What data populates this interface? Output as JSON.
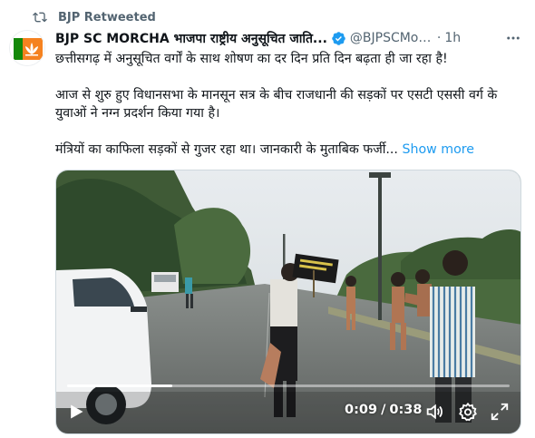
{
  "retweet": {
    "label": "BJP Retweeted",
    "icon": "retweet-icon"
  },
  "author": {
    "display_name": "BJP SC MORCHA भाजपा राष्ट्रीय अनुसूचित जाति...",
    "handle": "@BJPSCMor...",
    "dot": "·",
    "time": "1h",
    "verified": true,
    "verified_color": "#1d9bf0",
    "avatar_icon": "bjp-lotus-flag-avatar"
  },
  "tweet": {
    "paragraph1": "छत्तीसगढ़ में अनुसूचित वर्गों के साथ शोषण का दर दिन प्रति दिन बढ़ता ही जा रहा है!",
    "paragraph2": "आज से शुरु हुए विधानसभा के मानसून सत्र के बीच राजधानी की सड़कों पर एसटी एससी वर्ग के युवाओं ने नग्न प्रदर्शन किया गया है।",
    "paragraph3": "मंत्रियों का काफिला सड़कों से गुजर रहा था। जानकारी के मुताबिक फर्जी...",
    "show_more": "Show more",
    "link_color": "#1d9bf0"
  },
  "video": {
    "current_time": "0:09",
    "separator": "/",
    "duration": "0:38",
    "progress_fraction": 0.237,
    "icons": [
      "play-icon",
      "volume-icon",
      "settings-gear-icon",
      "fullscreen-icon"
    ]
  }
}
